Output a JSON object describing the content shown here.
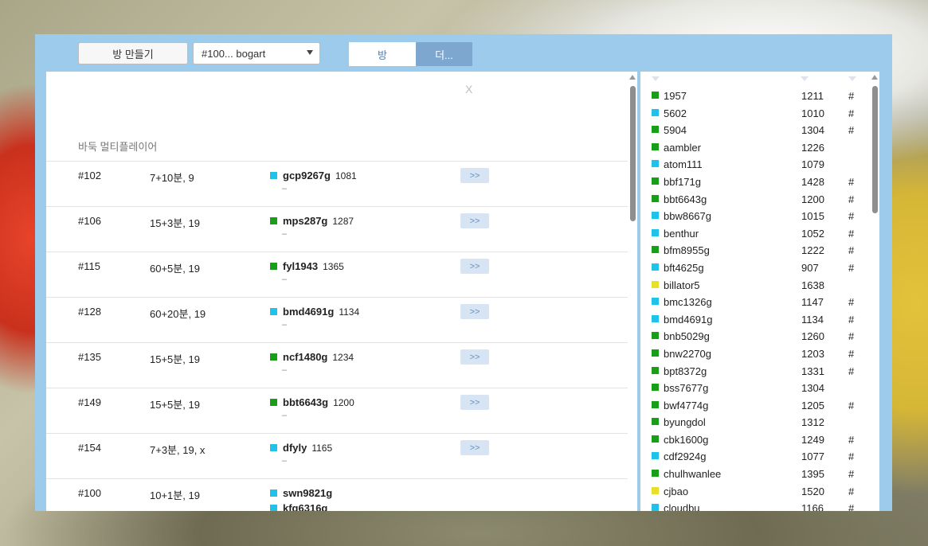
{
  "toolbar": {
    "create_room": "방 만들기",
    "room_select": "#100... bogart",
    "tab_room": "방",
    "tab_more": "더..."
  },
  "main": {
    "close": "X",
    "title": "바둑 멀티플레이어",
    "rows": [
      {
        "id": "#102",
        "time": "7+10분, 9",
        "p1": {
          "name": "gcp9267g",
          "rating": "1081",
          "color": "#1fc2e8"
        },
        "dash": "–",
        "go": ">>"
      },
      {
        "id": "#106",
        "time": "15+3분, 19",
        "p1": {
          "name": "mps287g",
          "rating": "1287",
          "color": "#1a9e1a"
        },
        "dash": "–",
        "go": ">>"
      },
      {
        "id": "#115",
        "time": "60+5분, 19",
        "p1": {
          "name": "fyl1943",
          "rating": "1365",
          "color": "#1a9e1a"
        },
        "dash": "–",
        "go": ">>"
      },
      {
        "id": "#128",
        "time": "60+20분, 19",
        "p1": {
          "name": "bmd4691g",
          "rating": "1134",
          "color": "#1fc2e8"
        },
        "dash": "–",
        "go": ">>"
      },
      {
        "id": "#135",
        "time": "15+5분, 19",
        "p1": {
          "name": "ncf1480g",
          "rating": "1234",
          "color": "#1a9e1a"
        },
        "dash": "–",
        "go": ">>"
      },
      {
        "id": "#149",
        "time": "15+5분, 19",
        "p1": {
          "name": "bbt6643g",
          "rating": "1200",
          "color": "#1a9e1a"
        },
        "dash": "–",
        "go": ">>"
      },
      {
        "id": "#154",
        "time": "7+3분, 19, x",
        "p1": {
          "name": "dfyly",
          "rating": "1165",
          "color": "#1fc2e8"
        },
        "dash": "–",
        "go": ">>"
      },
      {
        "id": "#100",
        "time": "10+1분, 19",
        "p1": {
          "name": "swn9821g",
          "rating": "",
          "color": "#1fc2e8"
        },
        "p2": {
          "name": "kfg6316g",
          "rating": "",
          "color": "#1fc2e8"
        }
      }
    ]
  },
  "users": [
    {
      "name": "1957",
      "rating": "1211",
      "hash": "#",
      "color": "#1a9e1a"
    },
    {
      "name": "5602",
      "rating": "1010",
      "hash": "#",
      "color": "#1fc2e8"
    },
    {
      "name": "5904",
      "rating": "1304",
      "hash": "#",
      "color": "#1a9e1a"
    },
    {
      "name": "aambler",
      "rating": "1226",
      "hash": "",
      "color": "#1a9e1a"
    },
    {
      "name": "atom111",
      "rating": "1079",
      "hash": "",
      "color": "#1fc2e8"
    },
    {
      "name": "bbf171g",
      "rating": "1428",
      "hash": "#",
      "color": "#1a9e1a"
    },
    {
      "name": "bbt6643g",
      "rating": "1200",
      "hash": "#",
      "color": "#1a9e1a"
    },
    {
      "name": "bbw8667g",
      "rating": "1015",
      "hash": "#",
      "color": "#1fc2e8"
    },
    {
      "name": "benthur",
      "rating": "1052",
      "hash": "#",
      "color": "#1fc2e8"
    },
    {
      "name": "bfm8955g",
      "rating": "1222",
      "hash": "#",
      "color": "#1a9e1a"
    },
    {
      "name": "bft4625g",
      "rating": "907",
      "hash": "#",
      "color": "#1fc2e8"
    },
    {
      "name": "billator5",
      "rating": "1638",
      "hash": "",
      "color": "#e6e02a"
    },
    {
      "name": "bmc1326g",
      "rating": "1147",
      "hash": "#",
      "color": "#1fc2e8"
    },
    {
      "name": "bmd4691g",
      "rating": "1134",
      "hash": "#",
      "color": "#1fc2e8"
    },
    {
      "name": "bnb5029g",
      "rating": "1260",
      "hash": "#",
      "color": "#1a9e1a"
    },
    {
      "name": "bnw2270g",
      "rating": "1203",
      "hash": "#",
      "color": "#1a9e1a"
    },
    {
      "name": "bpt8372g",
      "rating": "1331",
      "hash": "#",
      "color": "#1a9e1a"
    },
    {
      "name": "bss7677g",
      "rating": "1304",
      "hash": "",
      "color": "#1a9e1a"
    },
    {
      "name": "bwf4774g",
      "rating": "1205",
      "hash": "#",
      "color": "#1a9e1a"
    },
    {
      "name": "byungdol",
      "rating": "1312",
      "hash": "",
      "color": "#1a9e1a"
    },
    {
      "name": "cbk1600g",
      "rating": "1249",
      "hash": "#",
      "color": "#1a9e1a"
    },
    {
      "name": "cdf2924g",
      "rating": "1077",
      "hash": "#",
      "color": "#1fc2e8"
    },
    {
      "name": "chulhwanlee",
      "rating": "1395",
      "hash": "#",
      "color": "#1a9e1a"
    },
    {
      "name": "cjbao",
      "rating": "1520",
      "hash": "#",
      "color": "#e6e02a"
    },
    {
      "name": "cloudbu",
      "rating": "1166",
      "hash": "#",
      "color": "#1fc2e8"
    }
  ]
}
